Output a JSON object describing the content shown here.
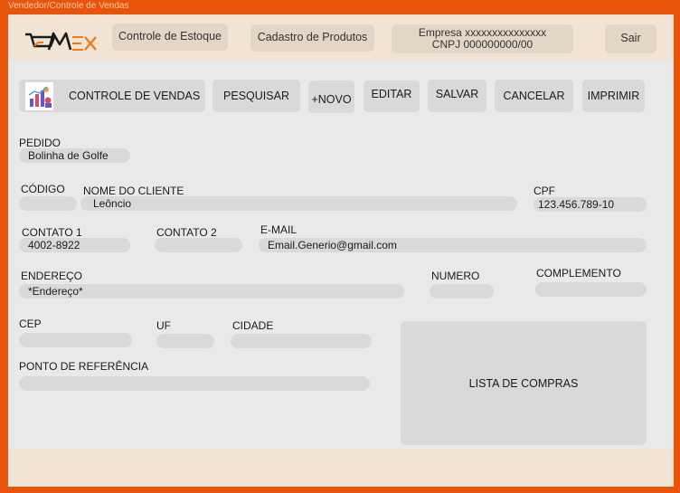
{
  "window": {
    "title": "Vendedor/Controle de Vendas"
  },
  "header": {
    "nav": {
      "stock": "Controle de Estoque",
      "products": "Cadastro de Produtos"
    },
    "company": {
      "name": "Empresa xxxxxxxxxxxxxxx",
      "cnpj": "CNPJ 000000000/00"
    },
    "logout": "Sair"
  },
  "toolbar": {
    "title": "CONTROLE DE VENDAS",
    "search": "PESQUISAR",
    "new": "+NOVO",
    "edit": "EDITAR",
    "save": "SALVAR",
    "cancel": "CANCELAR",
    "print": "IMPRIMIR"
  },
  "form": {
    "order": {
      "label": "PEDIDO",
      "value": "Bolinha de Golfe"
    },
    "code": {
      "label": "CÓDIGO",
      "value": ""
    },
    "client": {
      "label": "NOME DO CLIENTE",
      "value": "Leôncio"
    },
    "cpf": {
      "label": "CPF",
      "value": "123.456.789-10"
    },
    "contact1": {
      "label": "CONTATO 1",
      "value": "4002-8922"
    },
    "contact2": {
      "label": "CONTATO 2",
      "value": ""
    },
    "email": {
      "label": "E-MAIL",
      "value": "Email.Generio@gmail.com"
    },
    "address": {
      "label": "ENDEREÇO",
      "value": "*Endereço*"
    },
    "number": {
      "label": "NUMERO",
      "value": ""
    },
    "complement": {
      "label": "COMPLEMENTO",
      "value": ""
    },
    "cep": {
      "label": "CEP",
      "value": ""
    },
    "uf": {
      "label": "UF",
      "value": ""
    },
    "city": {
      "label": "CIDADE",
      "value": ""
    },
    "reference": {
      "label": "PONTO DE REFERÊNCIA",
      "value": ""
    }
  },
  "shopping_list": {
    "label": "LISTA DE COMPRAS"
  },
  "colors": {
    "frame": "#e8540a",
    "header": "#f1e4d4",
    "field": "#d9d9d9",
    "accent": "#f07a1a"
  }
}
